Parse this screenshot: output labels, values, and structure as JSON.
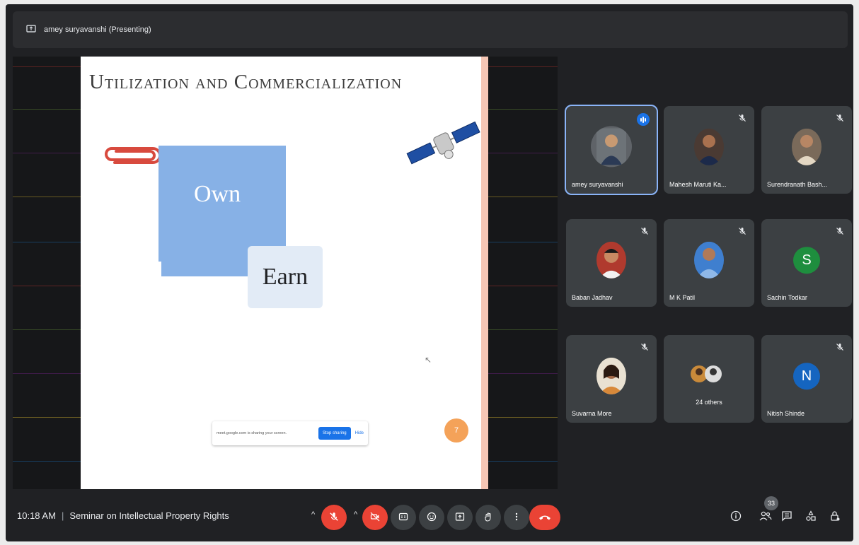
{
  "header": {
    "presenter": "amey suryavanshi (Presenting)"
  },
  "slide": {
    "title": "Utilization and Commercialization",
    "box_own": "Own",
    "box_earn": "Earn",
    "page": "7",
    "share_message": "meet.google.com is sharing your screen.",
    "stop_sharing_label": "Stop sharing",
    "hide_label": "Hide"
  },
  "participants": [
    {
      "name": "amey suryavanshi",
      "speaking": true
    },
    {
      "name": "Mahesh Maruti Ka..."
    },
    {
      "name": "Surendranath Bash..."
    },
    {
      "name": "Baban Jadhav"
    },
    {
      "name": "M K Patil"
    },
    {
      "name": "Sachin Todkar",
      "initial": "S",
      "color": "#1e8e3e"
    },
    {
      "name": "Suvarna More"
    },
    {
      "name": "24 others"
    },
    {
      "name": "Nitish Shinde",
      "initial": "N",
      "color": "#1565c0"
    }
  ],
  "bottom": {
    "time": "10:18 AM",
    "meeting_title": "Seminar on Intellectual Property Rights",
    "participant_count": "33"
  },
  "colors": {
    "accent": "#1a73e8",
    "danger": "#ea4335",
    "tile_bg": "#3c4043",
    "speaking_outline": "#8ab4f8"
  },
  "icons": [
    "presenting-icon",
    "mic-off-icon",
    "cam-off-icon",
    "captions-icon",
    "emoji-icon",
    "present-icon",
    "raise-hand-icon",
    "more-icon",
    "end-call-icon",
    "info-icon",
    "people-icon",
    "chat-icon",
    "activities-icon",
    "host-controls-icon"
  ]
}
